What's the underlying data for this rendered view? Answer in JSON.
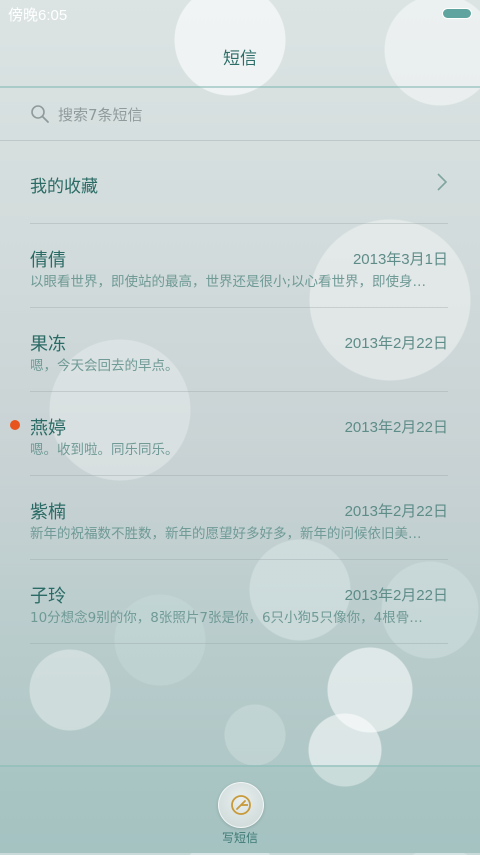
{
  "status_bar": {
    "time": "傍晚6:05",
    "battery_icon": "battery-icon"
  },
  "header": {
    "title": "短信"
  },
  "search": {
    "placeholder": "搜索7条短信",
    "icon": "search-icon"
  },
  "favorites": {
    "label": "我的收藏",
    "icon": "chevron-right-icon"
  },
  "conversations": [
    {
      "name": "倩倩",
      "date": "2013年3月1日",
      "preview": "以眼看世界，即使站的最高，世界还是很小;以心看世界，即使身…",
      "unread": false
    },
    {
      "name": "果冻",
      "date": "2013年2月22日",
      "preview": "嗯，今天会回去的早点。",
      "unread": false
    },
    {
      "name": "燕婷",
      "date": "2013年2月22日",
      "preview": "嗯。收到啦。同乐同乐。",
      "unread": true
    },
    {
      "name": "紫楠",
      "date": "2013年2月22日",
      "preview": "新年的祝福数不胜数，新年的愿望好多好多，新年的问候依旧美…",
      "unread": false
    },
    {
      "name": "子玲",
      "date": "2013年2月22日",
      "preview": "10分想念9别的你，8张照片7张是你，6只小狗5只像你，4根骨…",
      "unread": false
    }
  ],
  "bottom_bar": {
    "compose_label": "写短信",
    "compose_icon": "compose-icon"
  },
  "colors": {
    "accent": "#2b6b65",
    "unread": "#e8541e"
  }
}
